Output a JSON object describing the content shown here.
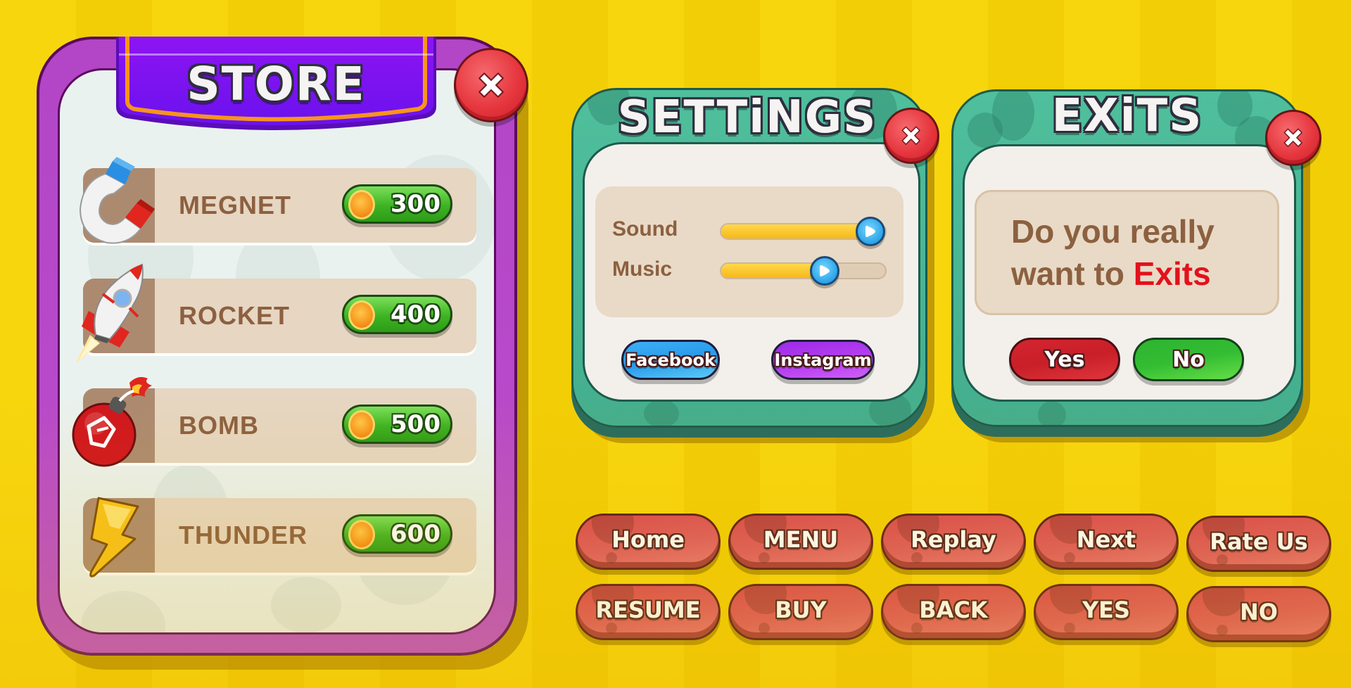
{
  "colors": {
    "background_yellow": "#F7D60E",
    "store_frame_purple": "#B246C6",
    "store_banner_violet": "#7A12F0",
    "banner_trim_orange": "#F7941D",
    "panel_teal": "#4FBF9C",
    "panel_cream": "#F3F0EC",
    "inset_beige": "#E8DAC6",
    "text_brown": "#8C6040",
    "price_green": "#3DB322",
    "close_red": "#E6363E",
    "grid_button_red": "#DE5A60",
    "exit_highlight_red": "#E3111B",
    "facebook_blue": "#2A9BEA",
    "instagram_purple": "#B33CF0"
  },
  "store": {
    "title": "STORE",
    "close_icon": "close-x-icon",
    "items": [
      {
        "name": "MEGNET",
        "icon": "magnet-icon",
        "price": "300",
        "currency_icon": "gold-coin-icon"
      },
      {
        "name": "ROCKET",
        "icon": "rocket-icon",
        "price": "400",
        "currency_icon": "gold-coin-icon"
      },
      {
        "name": "BOMB",
        "icon": "bomb-icon",
        "price": "500",
        "currency_icon": "gold-coin-icon"
      },
      {
        "name": "THUNDER",
        "icon": "lightning-icon",
        "price": "600",
        "currency_icon": "gold-coin-icon"
      }
    ]
  },
  "settings": {
    "title": "SETTiNGS",
    "close_icon": "close-x-icon",
    "sliders": [
      {
        "label": "Sound",
        "value_percent": 91
      },
      {
        "label": "Music",
        "value_percent": 63
      }
    ],
    "social_buttons": [
      {
        "label": "Facebook"
      },
      {
        "label": "Instagram"
      }
    ]
  },
  "exits": {
    "title": "EXiTS",
    "close_icon": "close-x-icon",
    "message_line1": "Do you really",
    "message_line2_prefix": "want to ",
    "message_line2_highlight": "Exits",
    "yes_label": "Yes",
    "no_label": "No"
  },
  "button_grid": {
    "row1": [
      "Home",
      "MENU",
      "Replay",
      "Next",
      "Rate Us"
    ],
    "row2": [
      "RESUME",
      "BUY",
      "BACK",
      "YES",
      "NO"
    ]
  }
}
